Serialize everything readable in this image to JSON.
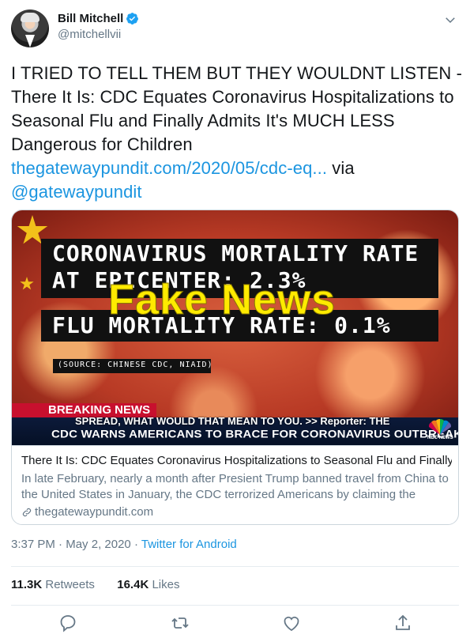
{
  "author": {
    "display_name": "Bill Mitchell",
    "handle": "@mitchellvii",
    "verified": true,
    "avatar_icon": "profile-photo-icon"
  },
  "tweet": {
    "text_main": "I TRIED TO TELL THEM BUT THEY WOULDNT LISTEN  - There It Is: CDC Equates Coronavirus Hospitalizations to Seasonal Flu and Finally Admits It's MUCH LESS Dangerous for Children",
    "link_text": "thegatewaypundit.com/2020/05/cdc-eq...",
    "via_text": "via",
    "mention": "@gatewaypundit"
  },
  "card": {
    "image": {
      "line1": "CORONAVIRUS MORTALITY RATE",
      "line2": "AT EPICENTER: 2.3%",
      "line3": "FLU MORTALITY RATE: 0.1%",
      "source": "(SOURCE: CHINESE CDC, NIAID)",
      "overlay": "Fake News",
      "breaking": "BREAKING NEWS",
      "subtitle": "SPREAD, WHAT WOULD THAT MEAN TO YOU. >> Reporter: THE",
      "headline": "CDC WARNS AMERICANS TO BRACE FOR CORONAVIRUS OUTBREAK",
      "network": "NBC NEWS"
    },
    "title": "There It Is: CDC Equates Coronavirus Hospitalizations to Seasonal Flu and Finally ...",
    "description": "In late February, nearly a month after Presient Trump banned travel from China to the United States in January, the CDC terrorized Americans by claiming the Wuh...",
    "domain": "thegatewaypundit.com"
  },
  "meta": {
    "time": "3:37 PM",
    "separator": "·",
    "date": "May 2, 2020",
    "source": "Twitter for Android"
  },
  "stats": {
    "retweets_count": "11.3K",
    "retweets_label": "Retweets",
    "likes_count": "16.4K",
    "likes_label": "Likes"
  },
  "colors": {
    "link": "#1b95e0",
    "secondary_text": "#657786",
    "border": "#ccd6dd"
  }
}
